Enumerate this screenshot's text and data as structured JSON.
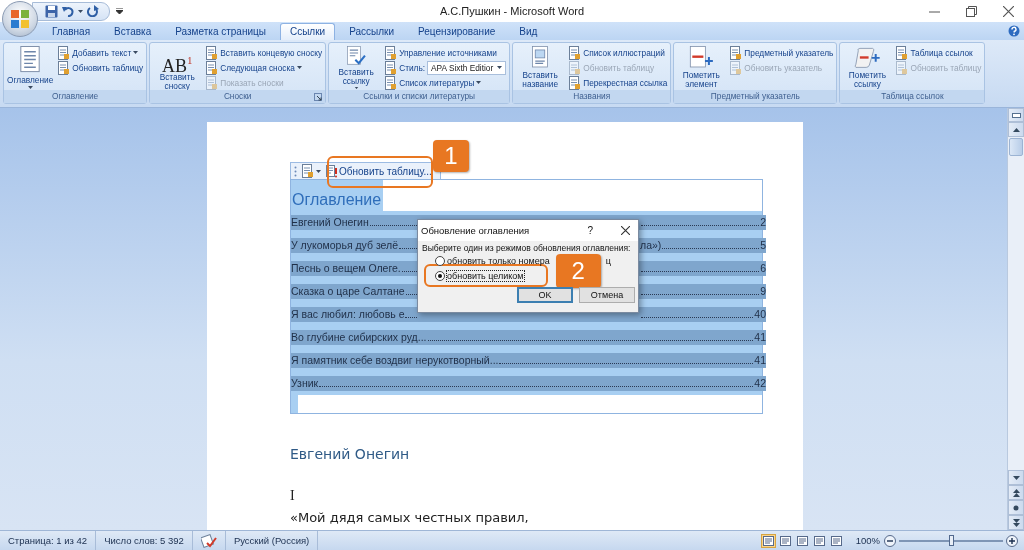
{
  "window": {
    "title": "А.С.Пушкин - Microsoft Word"
  },
  "tabs": [
    {
      "label": "Главная",
      "selected": false
    },
    {
      "label": "Вставка",
      "selected": false
    },
    {
      "label": "Разметка страницы",
      "selected": false
    },
    {
      "label": "Ссылки",
      "selected": true
    },
    {
      "label": "Рассылки",
      "selected": false
    },
    {
      "label": "Рецензирование",
      "selected": false
    },
    {
      "label": "Вид",
      "selected": false
    }
  ],
  "ribbon": {
    "groups": [
      {
        "label": "Оглавление",
        "launcher": false,
        "big": {
          "label": "Оглавление",
          "caret": true
        },
        "items": [
          {
            "kind": "dropdown",
            "label": "Добавить текст",
            "disabled": false
          },
          {
            "kind": "button",
            "label": "Обновить таблицу",
            "disabled": false
          }
        ]
      },
      {
        "label": "Сноски",
        "launcher": true,
        "big": {
          "label": "Вставить сноску",
          "icon_text": "AB$^{1}$"
        },
        "items": [
          {
            "kind": "button",
            "label": "Вставить концевую сноску",
            "disabled": false
          },
          {
            "kind": "dropdown",
            "label": "Следующая сноска",
            "disabled": false
          },
          {
            "kind": "button",
            "label": "Показать сноски",
            "disabled": true
          }
        ]
      },
      {
        "label": "Ссылки и списки литературы",
        "launcher": false,
        "big": {
          "label": "Вставить ссылку",
          "caret": true
        },
        "items": [
          {
            "kind": "button",
            "label": "Управление источниками",
            "disabled": false
          },
          {
            "kind": "combo",
            "label": "Стиль:",
            "value": "APA Sixth Editior",
            "disabled": false
          },
          {
            "kind": "dropdown",
            "label": "Список литературы",
            "disabled": false
          }
        ]
      },
      {
        "label": "Названия",
        "launcher": false,
        "big": {
          "label": "Вставить название",
          "caret": false
        },
        "items": [
          {
            "kind": "button",
            "label": "Список иллюстраций",
            "disabled": false
          },
          {
            "kind": "button",
            "label": "Обновить таблицу",
            "disabled": true
          },
          {
            "kind": "button",
            "label": "Перекрестная ссылка",
            "disabled": false
          }
        ]
      },
      {
        "label": "Предметный указатель",
        "launcher": false,
        "big": {
          "label": "Пометить элемент",
          "caret": false
        },
        "items": [
          {
            "kind": "button",
            "label": "Предметный указатель",
            "disabled": false
          },
          {
            "kind": "button",
            "label": "Обновить указатель",
            "disabled": true
          }
        ]
      },
      {
        "label": "Таблица ссылок",
        "launcher": false,
        "big": {
          "label": "Пометить ссылку",
          "caret": false
        },
        "items": [
          {
            "kind": "button",
            "label": "Таблица ссылок",
            "disabled": false
          },
          {
            "kind": "button",
            "label": "Обновить таблицу",
            "disabled": true
          }
        ]
      }
    ]
  },
  "content_control": {
    "button": "Обновить таблицу..."
  },
  "toc": {
    "heading": "Оглавление",
    "entries": [
      {
        "kind": "split",
        "title": "Евгений Онегин",
        "page": "2"
      },
      {
        "kind": "split",
        "title": "У лукоморья дуб зелё",
        "tail": "ла»)",
        "page": "5"
      },
      {
        "kind": "split",
        "title": "Песнь о вещем Олеге.",
        "page": "6"
      },
      {
        "kind": "split",
        "title": "Сказка о царе Салтане",
        "page": "9"
      },
      {
        "kind": "split",
        "title": "Я вас любил: любовь е",
        "page": "40"
      },
      {
        "kind": "full",
        "title": "Во глубине сибирских руд...",
        "page": "41"
      },
      {
        "kind": "full",
        "title": "Я памятник себе воздвиг нерукотворный...",
        "page": "41"
      },
      {
        "kind": "full",
        "title": "Узник",
        "page": "42"
      }
    ]
  },
  "body": [
    {
      "kind": "heading",
      "text": "Евгений Онегин"
    },
    {
      "kind": "numeral",
      "text": "I"
    },
    {
      "kind": "verse",
      "text": "«Мой дядя самых честных правил,"
    }
  ],
  "callouts": [
    {
      "number": "1"
    },
    {
      "number": "2"
    }
  ],
  "dialog": {
    "title": "Обновление оглавления",
    "help": "?",
    "prompt": "Выберите один из режимов обновления оглавления:",
    "options": [
      {
        "label": "обновить только номера",
        "tail": "ц",
        "selected": false,
        "focused": false
      },
      {
        "label": "обновить целиком",
        "selected": true,
        "focused": true
      }
    ],
    "buttons": [
      {
        "label": "OK",
        "default": true
      },
      {
        "label": "Отмена",
        "default": false
      }
    ]
  },
  "status_bar": {
    "page": "Страница: 1 из 42",
    "words": "Число слов: 5 392",
    "language": "Русский (Россия)",
    "views": [
      {
        "selected": true
      },
      {
        "selected": false
      },
      {
        "selected": false
      },
      {
        "selected": false
      },
      {
        "selected": false
      }
    ],
    "zoom": {
      "label": "100%",
      "level": 0.5
    }
  }
}
